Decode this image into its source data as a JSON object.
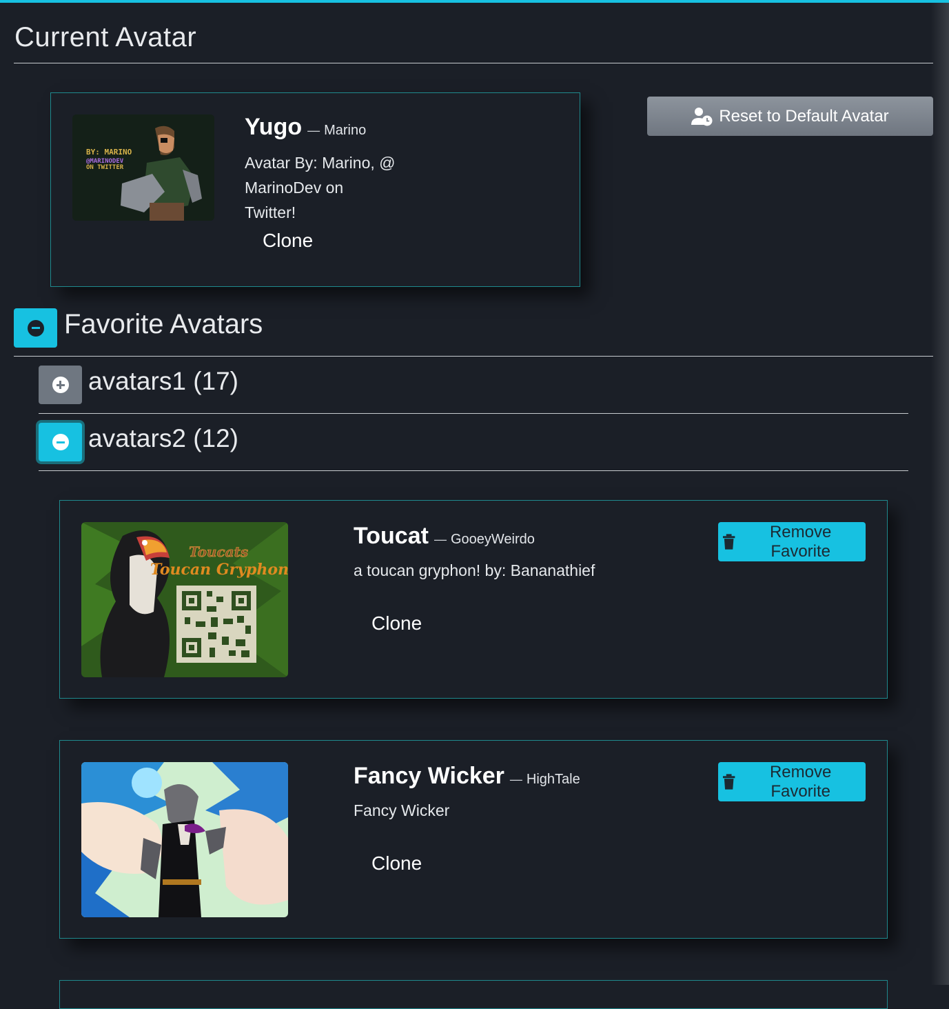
{
  "current": {
    "heading": "Current Avatar",
    "avatar": {
      "name": "Yugo",
      "author": "Marino",
      "description": "Avatar By: Marino, @ MarinoDev on Twitter!",
      "clone_label": "Clone",
      "thumb_text": "BY: MARINO @MARINODEV ON TWITTER"
    },
    "reset_label": "Reset to Default Avatar"
  },
  "favorites": {
    "heading": "Favorite Avatars",
    "groups": [
      {
        "label": "avatars1 (17)",
        "expanded": false
      },
      {
        "label": "avatars2 (12)",
        "expanded": true
      }
    ],
    "items": [
      {
        "name": "Toucat",
        "author": "GooeyWeirdo",
        "description": "a toucan gryphon! by: Bananathief",
        "clone_label": "Clone",
        "remove_label": "Remove Favorite",
        "thumb_title1": "Toucats",
        "thumb_title2": "Toucan Gryphons"
      },
      {
        "name": "Fancy Wicker",
        "author": "HighTale",
        "description": "Fancy Wicker",
        "clone_label": "Clone",
        "remove_label": "Remove Favorite"
      }
    ]
  },
  "colors": {
    "accent": "#17c1e1",
    "background": "#1b1f27",
    "card_border": "#1f8a8e",
    "secondary_button": "#6f7781"
  }
}
